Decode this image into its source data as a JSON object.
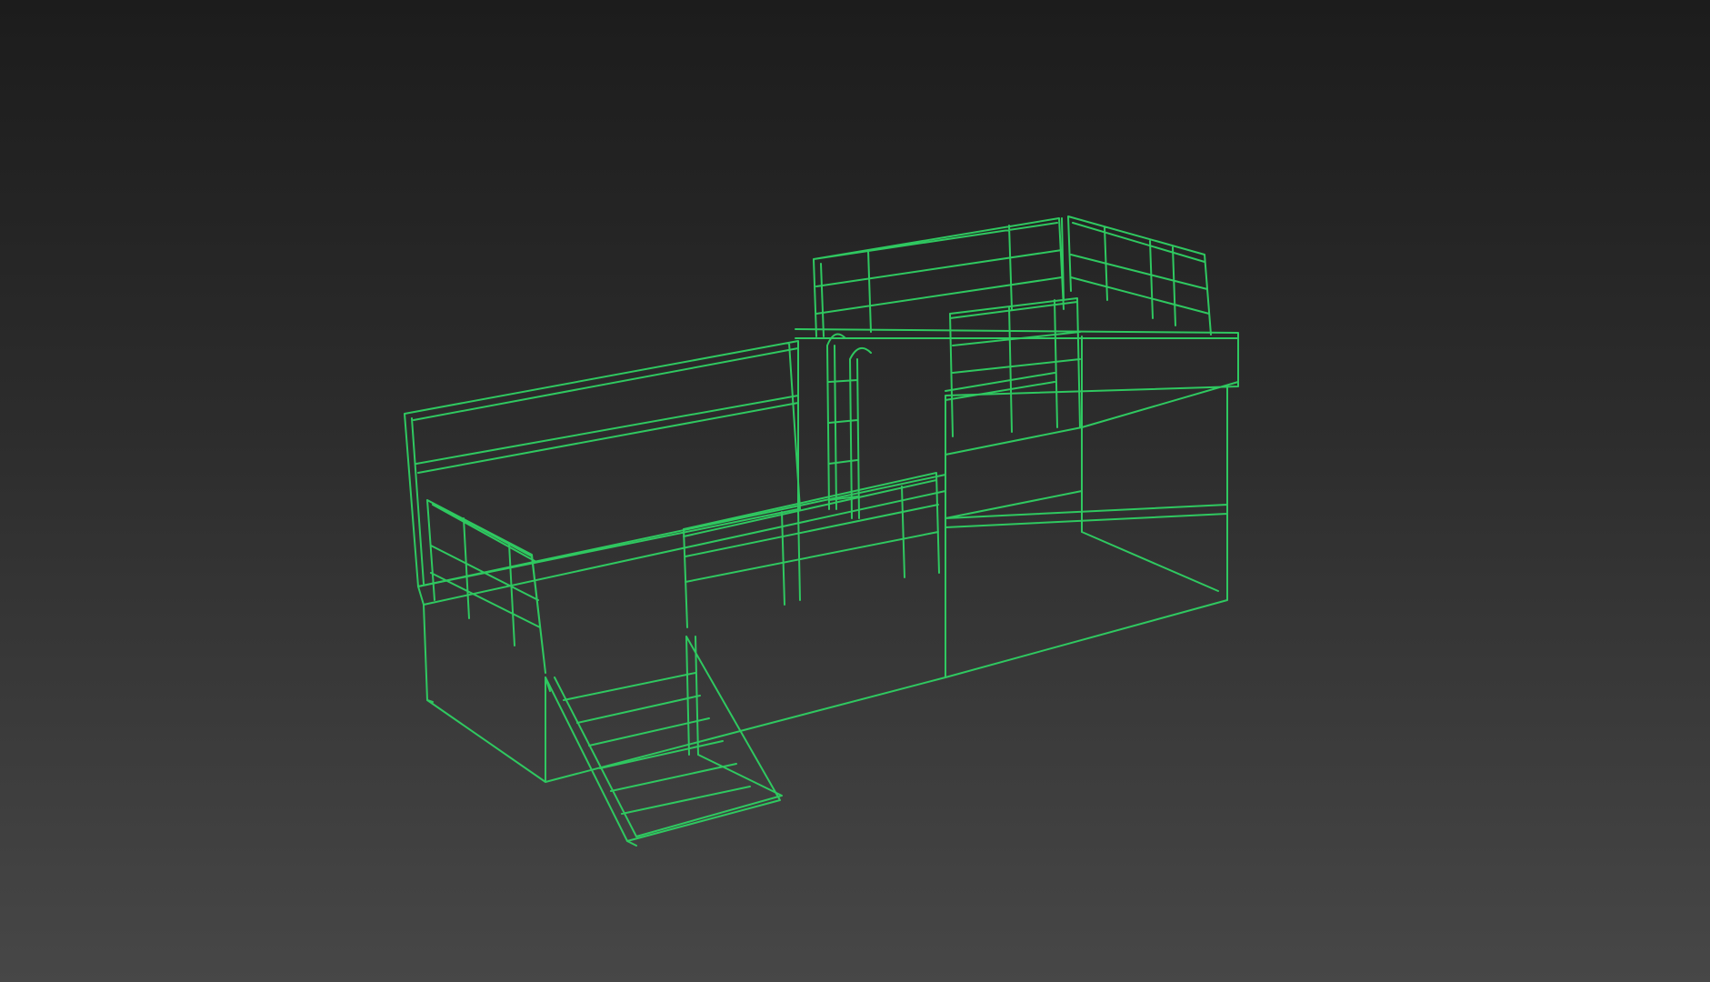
{
  "viewport": {
    "background_top": "#1c1c1c",
    "background_bottom": "#474747"
  },
  "model": {
    "wire_color": "#2fc860",
    "display_mode": "wireframe",
    "object": "bunk-bed-with-stairs"
  }
}
